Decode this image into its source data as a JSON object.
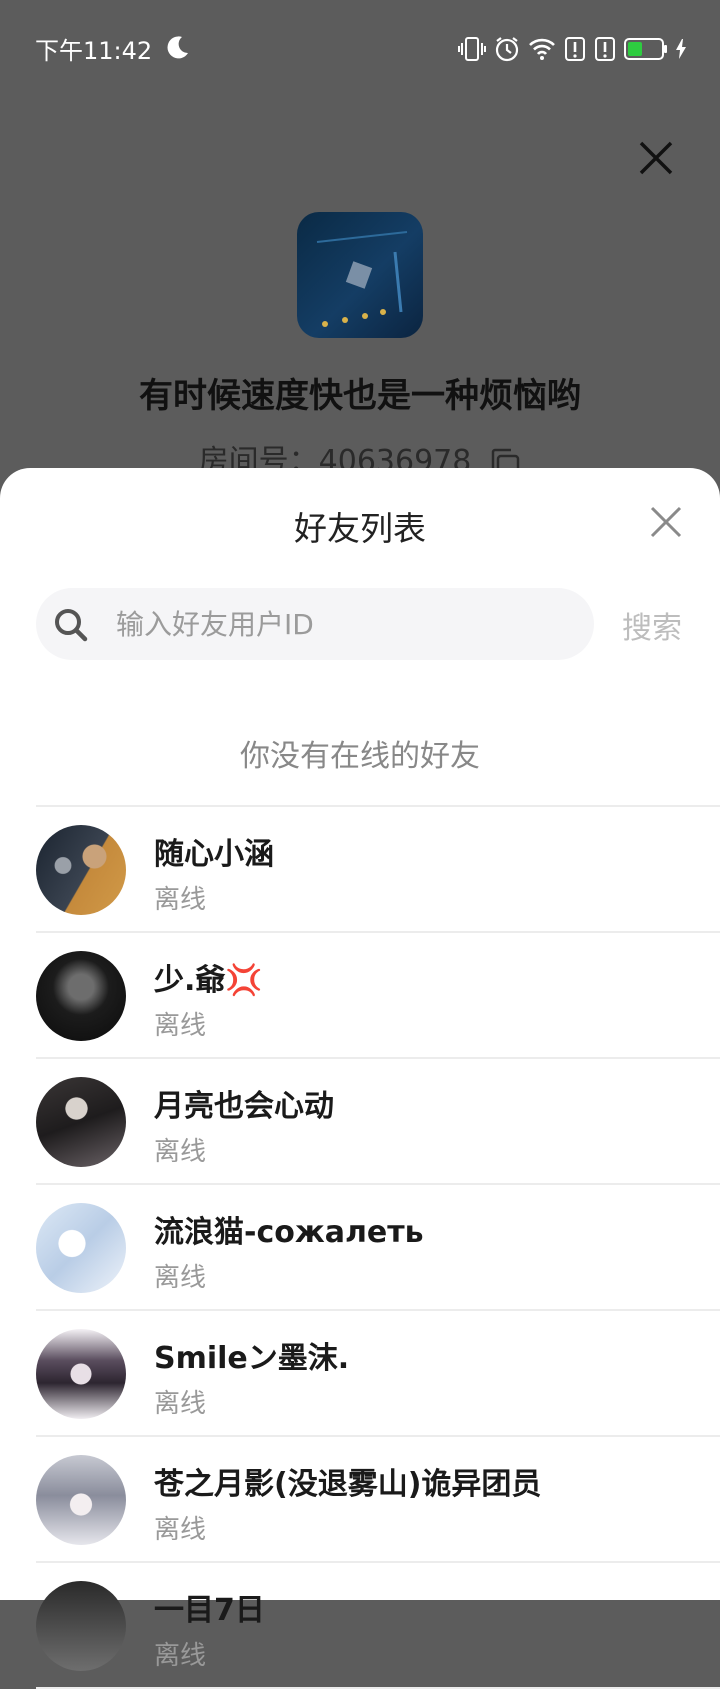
{
  "status_bar": {
    "time": "下午11:42",
    "icons": [
      "moon-icon",
      "vibrate-icon",
      "alarm-icon",
      "wifi-icon",
      "alert-icon",
      "alert-icon",
      "battery-icon",
      "charging-icon"
    ],
    "battery_color": "#2ecc40"
  },
  "room": {
    "title": "有时候速度快也是一种烦恼哟",
    "id_label": "房间号：",
    "id_value": "40636978"
  },
  "sheet": {
    "title": "好友列表",
    "search_placeholder": "输入好友用户ID",
    "search_button": "搜索",
    "empty_note": "你没有在线的好友"
  },
  "friends": [
    {
      "name": "随心小涵",
      "status": "离线"
    },
    {
      "name": "少.爺💢",
      "status": "离线"
    },
    {
      "name": "月亮也会心动",
      "status": "离线"
    },
    {
      "name": "流浪猫-сожалеть",
      "status": "离线"
    },
    {
      "name": "Smileン墨沫.",
      "status": "离线"
    },
    {
      "name": "苍之月影(没退雾山)诡异团员",
      "status": "离线"
    },
    {
      "name": "一目7日",
      "status": "离线"
    }
  ],
  "colors": {
    "overlay": "#5c5c5c",
    "sheet_bg": "#ffffff",
    "search_bg": "#f5f5f7",
    "muted_text": "#999999"
  }
}
